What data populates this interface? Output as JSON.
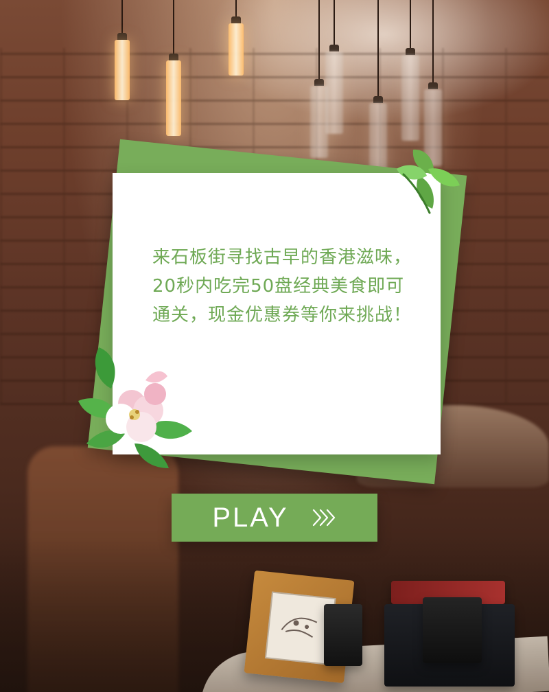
{
  "card": {
    "text": "来石板街寻找古早的香港滋味，20秒内吃完50盘经典美食即可通关，现金优惠券等你来挑战！"
  },
  "play_button": {
    "label": "PLAY"
  },
  "icons": {
    "arrows": "double-chevron-right-icon",
    "leaf": "leaf-icon",
    "flower": "flower-icon"
  },
  "colors": {
    "green": "#75ab57",
    "text_green": "#6fa955",
    "card_bg": "#ffffff"
  }
}
